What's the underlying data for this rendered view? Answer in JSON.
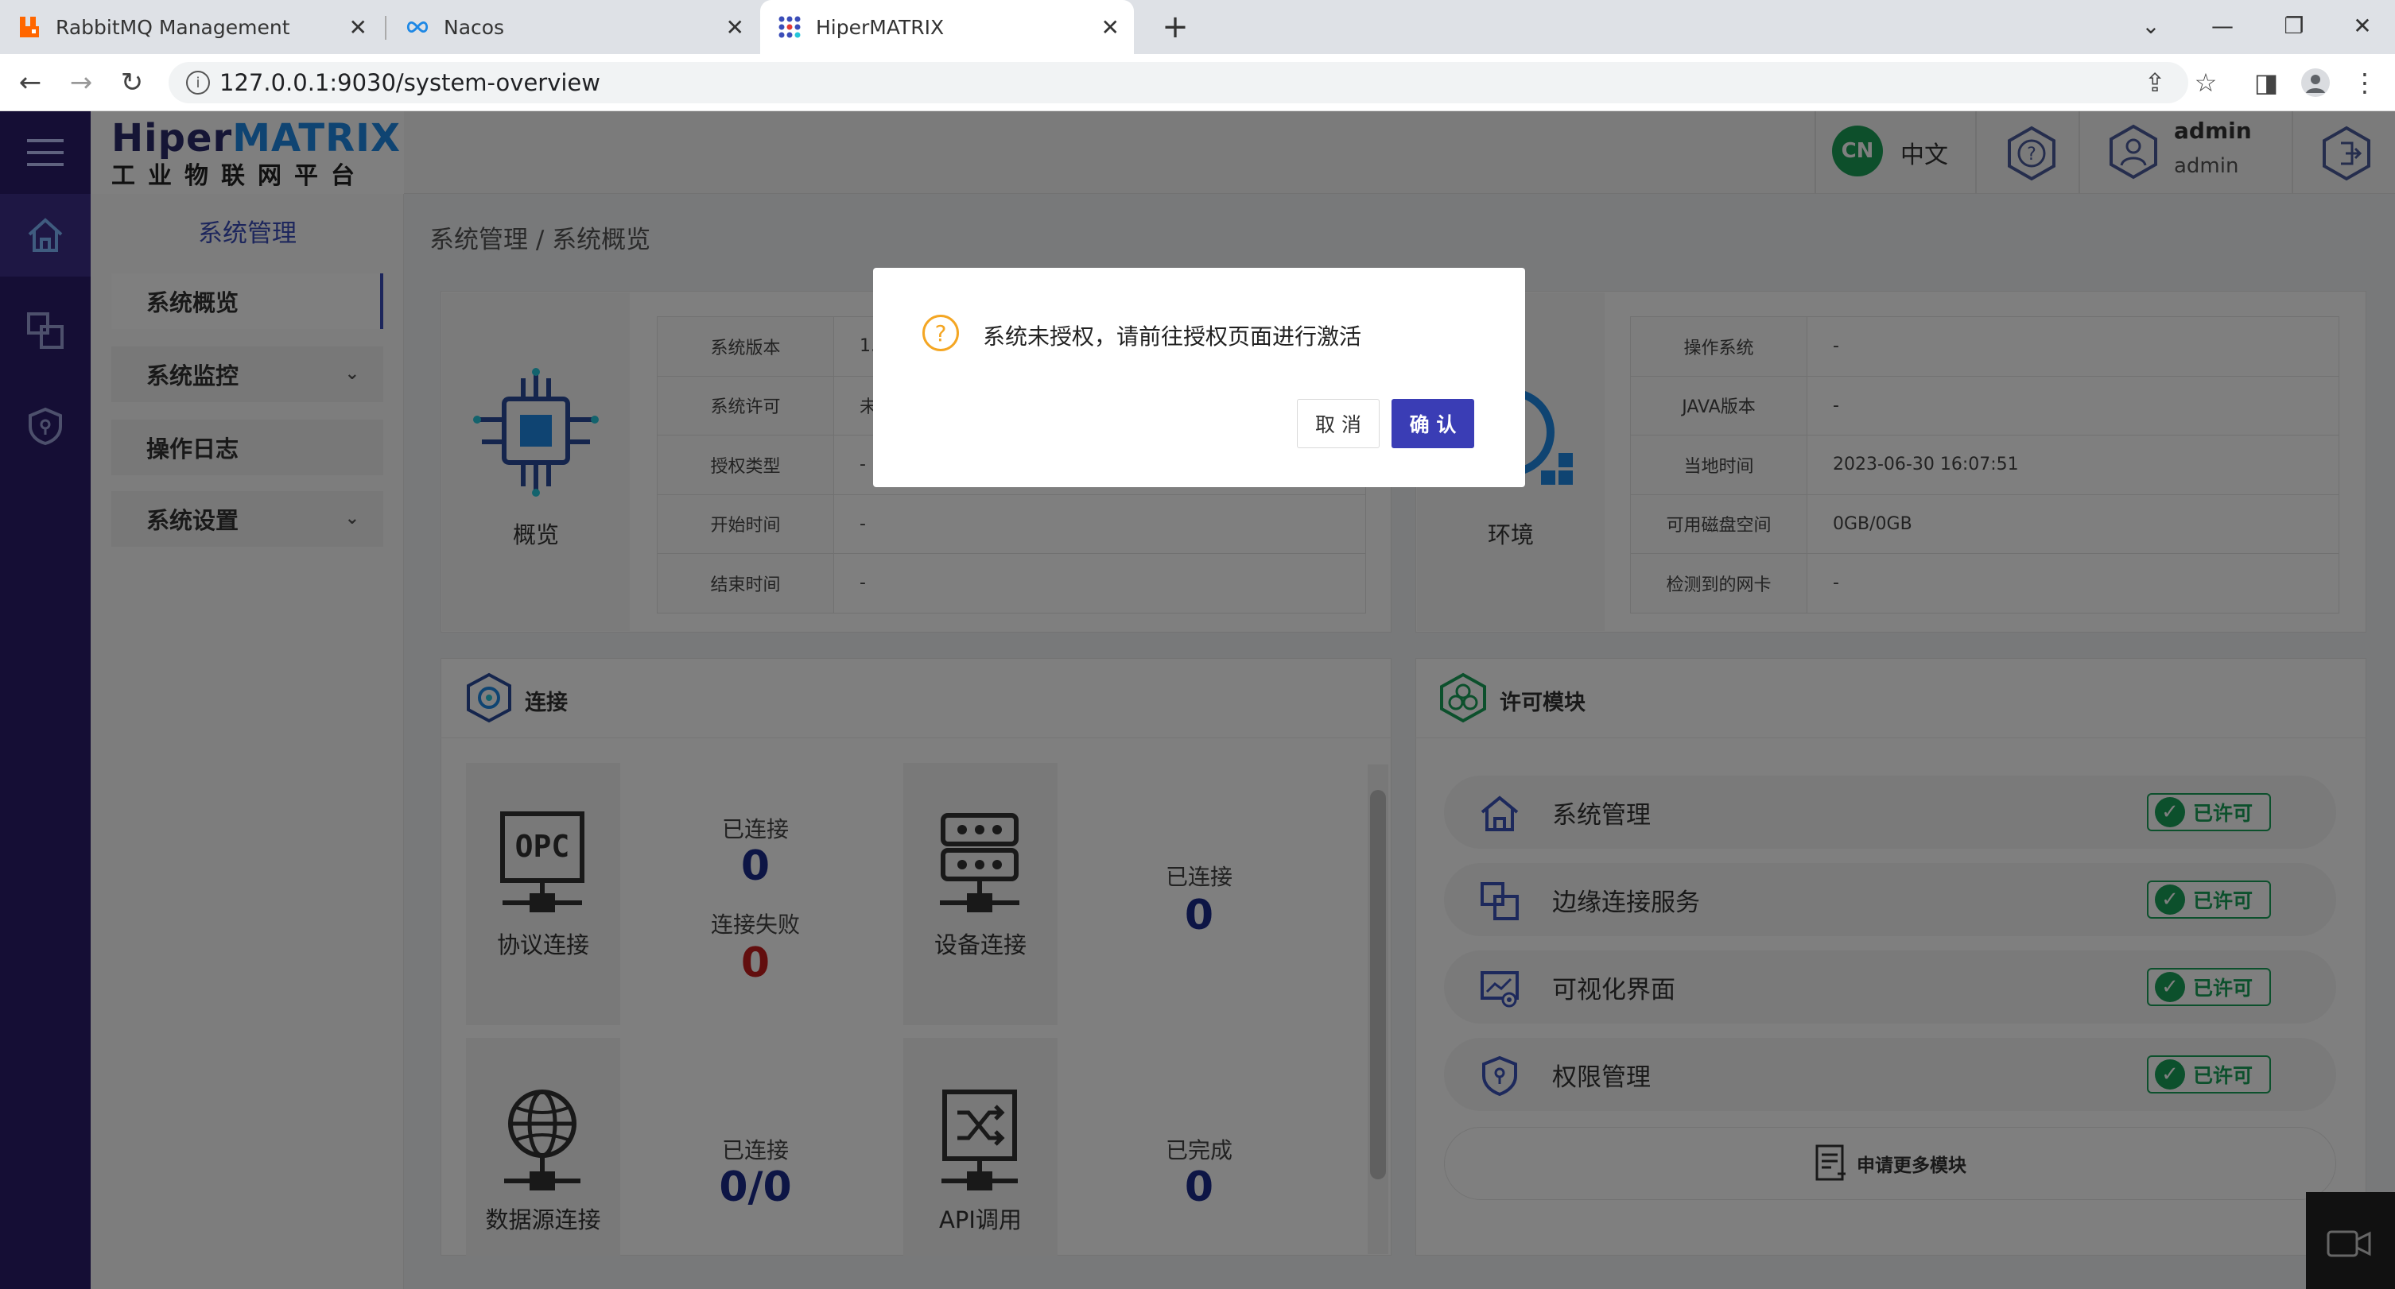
{
  "browser": {
    "tabs": [
      {
        "title": "RabbitMQ Management",
        "favicon": "rabbitmq-icon",
        "color": "#ff6600"
      },
      {
        "title": "Nacos",
        "favicon": "nacos-infinity-icon",
        "color": "#1e88e5"
      },
      {
        "title": "HiperMATRIX",
        "favicon": "hipermatrix-dots-icon",
        "color": "#3b4db8",
        "active": true
      }
    ],
    "url": "127.0.0.1:9030/system-overview"
  },
  "app": {
    "logo_main_a": "Hiper",
    "logo_main_b": "MATRIX",
    "logo_sub": "工业物联网平台",
    "lang_badge": "CN",
    "lang_label": "中文",
    "user_name": "admin",
    "user_role": "admin"
  },
  "sidebar": {
    "title": "系统管理",
    "items": [
      {
        "label": "系统概览",
        "active": true
      },
      {
        "label": "系统监控",
        "has_children": true
      },
      {
        "label": "操作日志"
      },
      {
        "label": "系统设置",
        "has_children": true
      }
    ]
  },
  "breadcrumb": "系统管理 / 系统概览",
  "overview_card": {
    "label": "概览",
    "rows": [
      {
        "key": "系统版本",
        "value": "1."
      },
      {
        "key": "系统许可",
        "value": "未"
      },
      {
        "key": "授权类型",
        "value": "-"
      },
      {
        "key": "开始时间",
        "value": "-"
      },
      {
        "key": "结束时间",
        "value": "-"
      }
    ]
  },
  "env_card": {
    "label": "环境",
    "rows": [
      {
        "key": "操作系统",
        "value": "-"
      },
      {
        "key": "JAVA版本",
        "value": "-"
      },
      {
        "key": "当地时间",
        "value": "2023-06-30 16:07:51"
      },
      {
        "key": "可用磁盘空间",
        "value": "0GB/0GB"
      },
      {
        "key": "检测到的网卡",
        "value": "-"
      }
    ]
  },
  "connection_card": {
    "title": "连接",
    "tiles": [
      {
        "label": "协议连接",
        "icon": "opc-server-icon",
        "stats": [
          {
            "label": "已连接",
            "value": "0",
            "color": "blue"
          },
          {
            "label": "连接失败",
            "value": "0",
            "color": "red"
          }
        ]
      },
      {
        "label": "设备连接",
        "icon": "device-server-icon",
        "stats": [
          {
            "label": "已连接",
            "value": "0",
            "color": "blue"
          }
        ]
      },
      {
        "label": "数据源连接",
        "icon": "globe-network-icon",
        "stats": [
          {
            "label": "已连接",
            "value": "0/0",
            "color": "blue"
          }
        ]
      },
      {
        "label": "API调用",
        "icon": "shuffle-api-icon",
        "stats": [
          {
            "label": "已完成",
            "value": "0",
            "color": "blue"
          }
        ]
      }
    ]
  },
  "license_card": {
    "title": "许可模块",
    "modules": [
      {
        "label": "系统管理",
        "icon": "home-icon",
        "status": "已许可"
      },
      {
        "label": "边缘连接服务",
        "icon": "edge-connect-icon",
        "status": "已许可"
      },
      {
        "label": "可视化界面",
        "icon": "visual-screen-icon",
        "status": "已许可"
      },
      {
        "label": "权限管理",
        "icon": "shield-icon",
        "status": "已许可"
      }
    ],
    "more_label": "申请更多模块"
  },
  "dialog": {
    "message": "系统未授权，请前往授权页面进行激活",
    "cancel_label": "取 消",
    "ok_label": "确 认"
  },
  "colors": {
    "rail": "#2a1d6b",
    "primary": "#3a3db5",
    "success": "#18a058",
    "danger": "#c41d1d",
    "warning": "#f4a623"
  }
}
